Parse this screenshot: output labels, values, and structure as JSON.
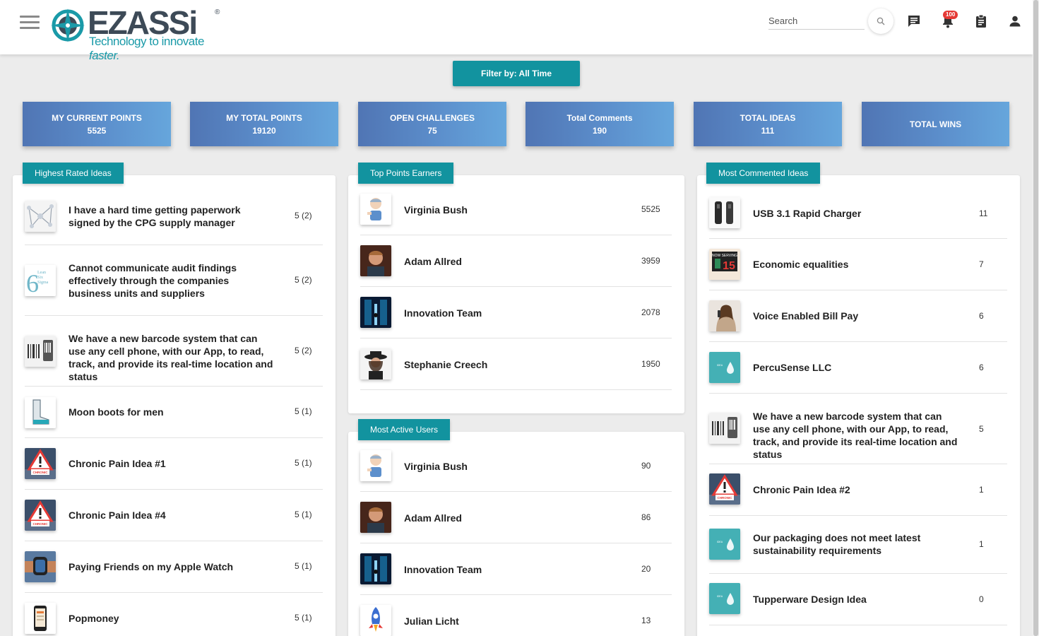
{
  "header": {
    "brand": "EZASSi",
    "tagline": "Technology to innovate",
    "tagline_em": "faster.",
    "search_placeholder": "Search",
    "notification_count": "100"
  },
  "filter": {
    "label": "Filter by: All Time"
  },
  "stats": [
    {
      "label": "MY CURRENT POINTS",
      "value": "5525"
    },
    {
      "label": "MY TOTAL POINTS",
      "value": "19120"
    },
    {
      "label": "OPEN CHALLENGES",
      "value": "75"
    },
    {
      "label": "Total Comments",
      "value": "190"
    },
    {
      "label": "TOTAL IDEAS",
      "value": "111"
    },
    {
      "label": "TOTAL WINS",
      "value": ""
    }
  ],
  "highest_rated": {
    "title": "Highest Rated Ideas",
    "items": [
      {
        "text": "I have a hard time getting paperwork signed by the CPG supply manager",
        "rating": "5 (2)",
        "icon": "network-thumb"
      },
      {
        "text": "Cannot communicate audit findings effectively through the companies business units and suppliers",
        "rating": "5 (2)",
        "icon": "six-sigma-thumb"
      },
      {
        "text": "We have a new barcode system that can use any cell phone, with our App, to read, track, and provide its real-time location and status",
        "rating": "5 (2)",
        "icon": "barcode-thumb"
      },
      {
        "text": "Moon boots for men",
        "rating": "5 (1)",
        "icon": "boot-thumb"
      },
      {
        "text": "Chronic Pain Idea #1",
        "rating": "5 (1)",
        "icon": "chronic-pain-thumb"
      },
      {
        "text": "Chronic Pain Idea #4",
        "rating": "5 (1)",
        "icon": "chronic-pain-thumb"
      },
      {
        "text": "Paying Friends on my Apple Watch",
        "rating": "5 (1)",
        "icon": "watch-thumb"
      },
      {
        "text": "Popmoney",
        "rating": "5 (1)",
        "icon": "phone-thumb"
      }
    ]
  },
  "top_points": {
    "title": "Top Points Earners",
    "items": [
      {
        "name": "Virginia Bush",
        "value": "5525",
        "icon": "cartoon-avatar"
      },
      {
        "name": "Adam Allred",
        "value": "3959",
        "icon": "man-avatar"
      },
      {
        "name": "Innovation Team",
        "value": "2078",
        "icon": "team-avatar"
      },
      {
        "name": "Stephanie Creech",
        "value": "1950",
        "icon": "woman-hat-avatar"
      }
    ]
  },
  "most_active": {
    "title": "Most Active Users",
    "items": [
      {
        "name": "Virginia Bush",
        "value": "90",
        "icon": "cartoon-avatar"
      },
      {
        "name": "Adam Allred",
        "value": "86",
        "icon": "man-avatar"
      },
      {
        "name": "Innovation Team",
        "value": "20",
        "icon": "team-avatar"
      },
      {
        "name": "Julian Licht",
        "value": "13",
        "icon": "rocket-avatar"
      }
    ]
  },
  "most_commented": {
    "title": "Most Commented Ideas",
    "items": [
      {
        "text": "USB 3.1 Rapid Charger",
        "count": "11",
        "icon": "charger-thumb"
      },
      {
        "text": "Economic equalities",
        "count": "7",
        "icon": "now-serving-thumb"
      },
      {
        "text": "Voice Enabled Bill Pay",
        "count": "6",
        "icon": "woman-phone-thumb"
      },
      {
        "text": "PercuSense LLC",
        "count": "6",
        "icon": "drop-thumb"
      },
      {
        "text": "We have a new barcode system that can use any cell phone, with our App, to read, track, and provide its real-time location and status",
        "count": "5",
        "icon": "barcode-thumb"
      },
      {
        "text": "Chronic Pain Idea #2",
        "count": "1",
        "icon": "chronic-pain-thumb"
      },
      {
        "text": "Our packaging does not meet latest sustainability requirements",
        "count": "1",
        "icon": "drop-thumb"
      },
      {
        "text": "Tupperware Design Idea",
        "count": "0",
        "icon": "drop-thumb"
      }
    ]
  }
}
